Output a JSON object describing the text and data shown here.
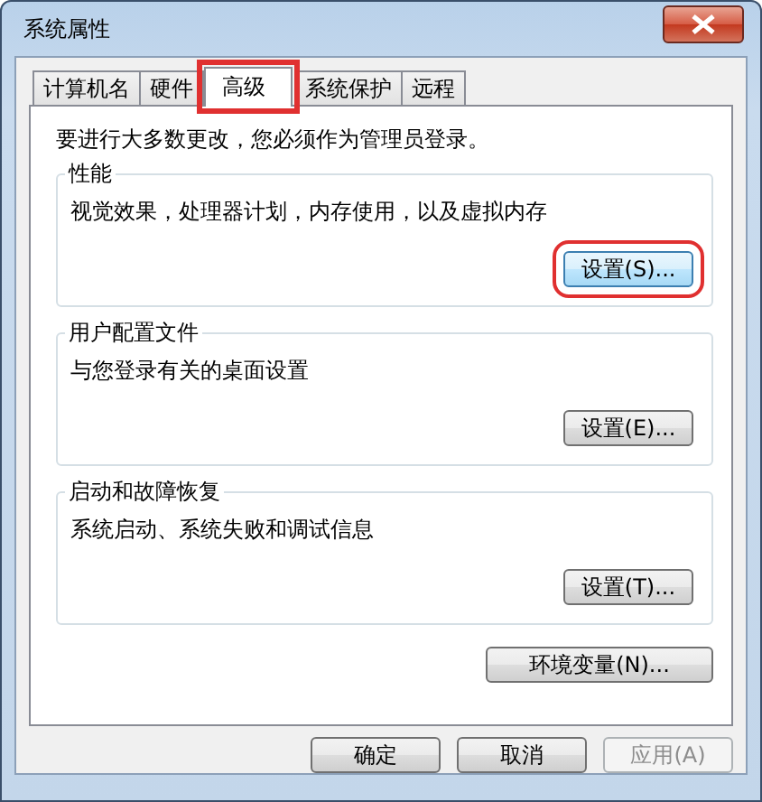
{
  "window": {
    "title": "系统属性"
  },
  "tabs": [
    {
      "label": "计算机名",
      "selected": false,
      "highlighted": false
    },
    {
      "label": "硬件",
      "selected": false,
      "highlighted": false
    },
    {
      "label": "高级",
      "selected": true,
      "highlighted": true
    },
    {
      "label": "系统保护",
      "selected": false,
      "highlighted": false
    },
    {
      "label": "远程",
      "selected": false,
      "highlighted": false
    }
  ],
  "notice": "要进行大多数更改，您必须作为管理员登录。",
  "groups": [
    {
      "title": "性能",
      "description": "视觉效果，处理器计划，内存使用，以及虚拟内存",
      "button": {
        "label": "设置(S)...",
        "highlighted": true
      }
    },
    {
      "title": "用户配置文件",
      "description": "与您登录有关的桌面设置",
      "button": {
        "label": "设置(E)...",
        "highlighted": false
      }
    },
    {
      "title": "启动和故障恢复",
      "description": "系统启动、系统失败和调试信息",
      "button": {
        "label": "设置(T)...",
        "highlighted": false
      }
    }
  ],
  "env_button": {
    "label": "环境变量(N)..."
  },
  "buttons": [
    {
      "label": "确定",
      "disabled": false
    },
    {
      "label": "取消",
      "disabled": false
    },
    {
      "label": "应用(A)",
      "disabled": true
    }
  ]
}
